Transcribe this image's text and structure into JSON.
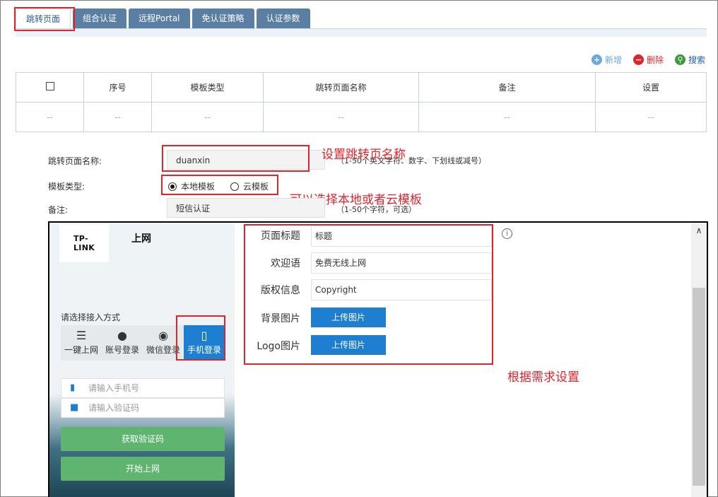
{
  "tabs": [
    "跳转页面",
    "组合认证",
    "远程Portal",
    "免认证策略",
    "认证参数"
  ],
  "toolbar": {
    "add": "新增",
    "delete": "删除",
    "search": "搜索",
    "colors": {
      "add": "#6aa8e0",
      "delete": "#d9282f",
      "search": "#3c9a3c"
    }
  },
  "table": {
    "headers": [
      "序号",
      "模板类型",
      "跳转页面名称",
      "备注",
      "设置"
    ],
    "empty_row": [
      "--",
      "--",
      "--",
      "--",
      "--",
      "--"
    ]
  },
  "form": {
    "name_label": "跳转页面名称:",
    "name_value": "duanxin",
    "name_hint": "（1-50个英文字符、数字、下划线或减号）",
    "type_label": "模板类型:",
    "type_options": [
      "本地模板",
      "云模板"
    ],
    "type_selected": "本地模板",
    "note_label": "备注:",
    "note_value": "短信认证",
    "note_hint": "（1-50个字符，可选）"
  },
  "annotations": {
    "name": "设置跳转页名称",
    "type": "可以选择本地或者云模板",
    "settings": "根据需求设置"
  },
  "preview": {
    "brand": "TP-LINK",
    "title": "上网",
    "access_label": "请选择接入方式",
    "methods": [
      "一键上网",
      "账号登录",
      "微信登录",
      "手机登录"
    ],
    "active_method": "手机登录",
    "phone_placeholder": "请输入手机号",
    "code_placeholder": "请输入验证码",
    "get_code": "获取验证码",
    "start": "开始上网",
    "settings": {
      "page_title_label": "页面标题",
      "page_title_value": "标题",
      "welcome_label": "欢迎语",
      "welcome_value": "免费无线上网",
      "copyright_label": "版权信息",
      "copyright_value": "Copyright",
      "bg_label": "背景图片",
      "logo_label": "Logo图片",
      "upload": "上传图片"
    }
  }
}
